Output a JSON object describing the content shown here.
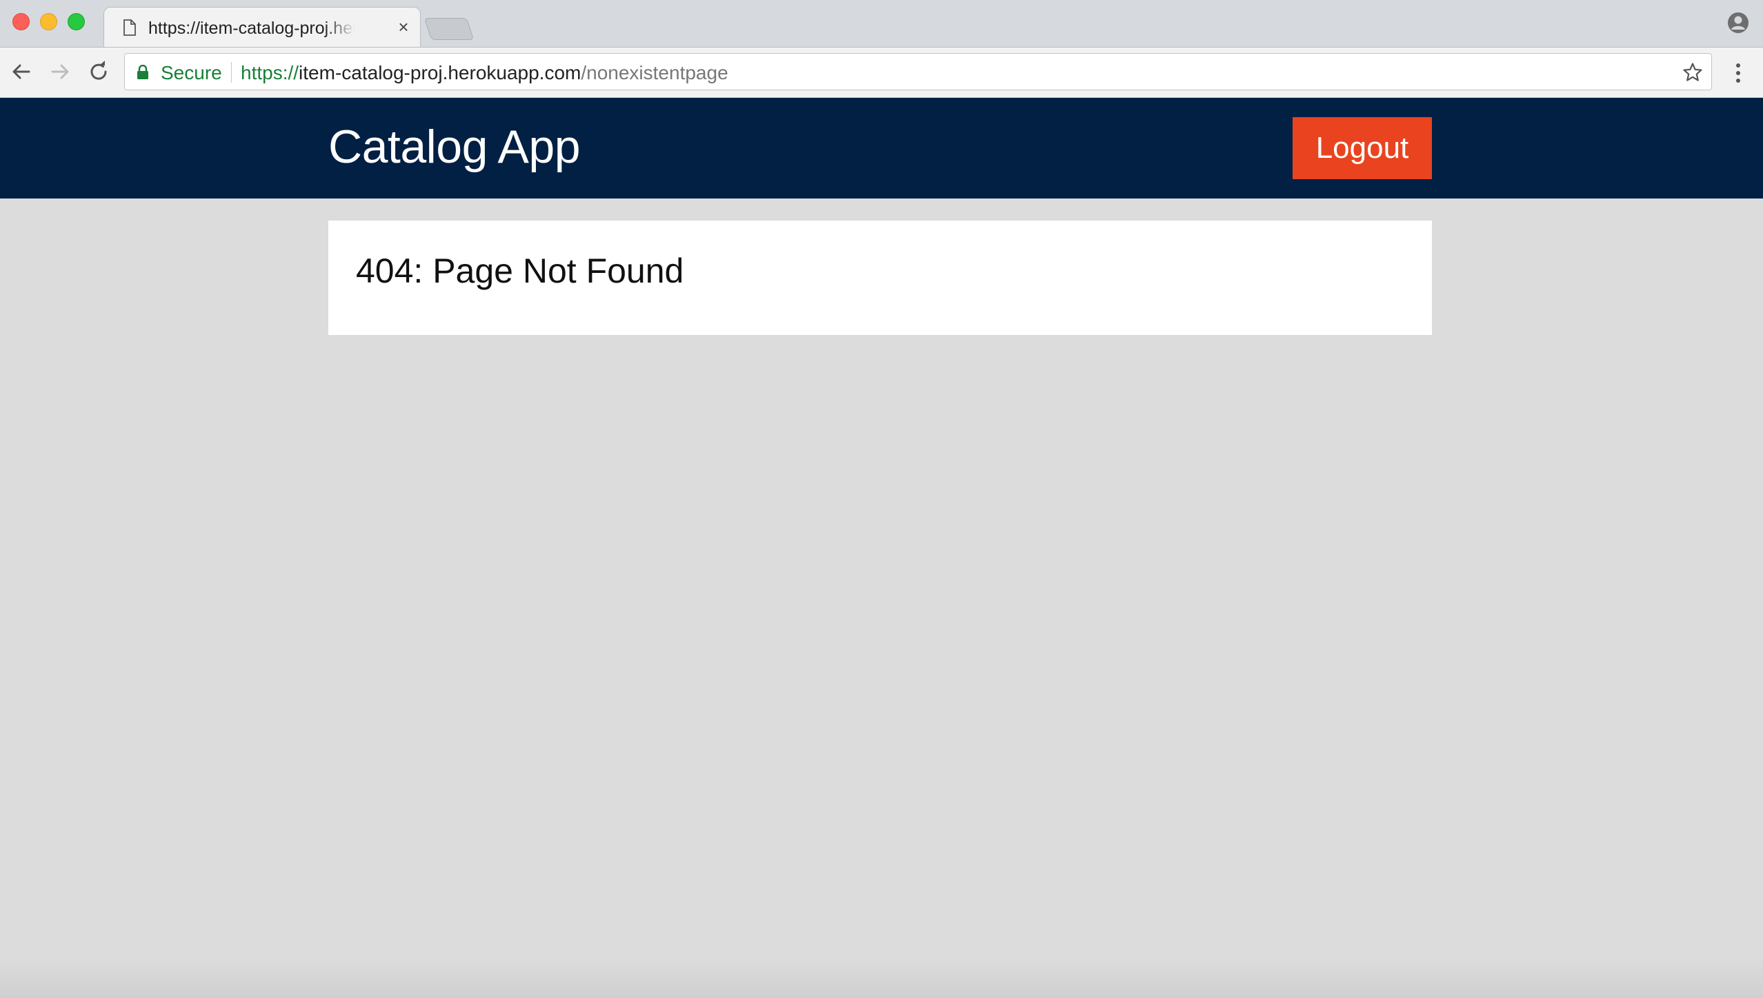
{
  "browser": {
    "tab": {
      "title": "https://item-catalog-proj.herokuapp.com/nonexistentpage",
      "close_glyph": "×"
    },
    "omnibox": {
      "security_label": "Secure",
      "url_scheme": "https://",
      "url_host": "item-catalog-proj.herokuapp.com",
      "url_path": "/nonexistentpage"
    },
    "icons": {
      "tab_page": "page-icon",
      "back": "arrow-left-icon",
      "forward": "arrow-right-icon",
      "reload": "reload-icon",
      "lock": "lock-icon",
      "bookmark": "star-icon",
      "menu": "kebab-menu-icon",
      "profile": "profile-icon"
    }
  },
  "app": {
    "brand": "Catalog App",
    "logout_label": "Logout",
    "error_message": "404: Page Not Found"
  },
  "colors": {
    "navbar_bg": "#012043",
    "logout_bg": "#e9441f",
    "page_bg": "#dcdcdc",
    "card_bg": "#ffffff",
    "secure_green": "#188038"
  }
}
